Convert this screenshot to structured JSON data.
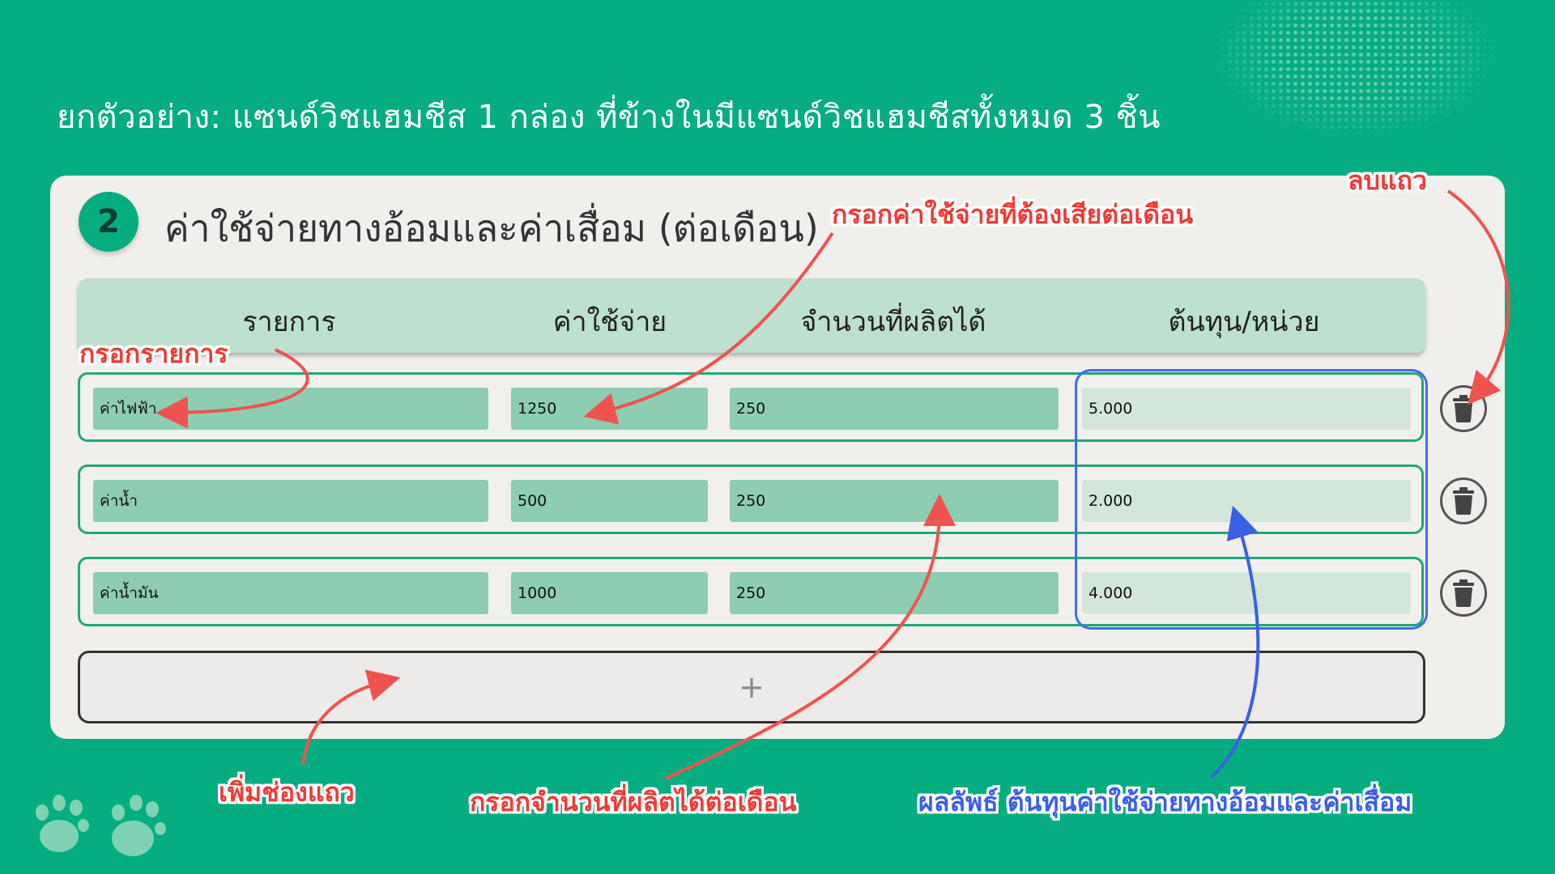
{
  "top_caption": "ยกตัวอย่าง: แซนด์วิชแฮมชีส 1 กล่อง ที่ข้างในมีแซนด์วิชแฮมชีสทั้งหมด 3 ชิ้น",
  "section": {
    "step_number": "2",
    "title": "ค่าใช้จ่ายทางอ้อมและค่าเสื่อม (ต่อเดือน)"
  },
  "table": {
    "headers": [
      "รายการ",
      "ค่าใช้จ่าย",
      "จำนวนที่ผลิตได้",
      "ต้นทุน/หน่วย"
    ],
    "rows": [
      {
        "name": "ค่าไฟฟ้า",
        "cost": "1250",
        "qty": "250",
        "unit_cost": "5.000"
      },
      {
        "name": "ค่าน้ำ",
        "cost": "500",
        "qty": "250",
        "unit_cost": "2.000"
      },
      {
        "name": "ค่าน้ำมัน",
        "cost": "1000",
        "qty": "250",
        "unit_cost": "4.000"
      }
    ],
    "add_row_symbol": "+"
  },
  "annotations": {
    "enter_item": "กรอกรายการ",
    "enter_cost": "กรอกค่าใช้จ่ายที่ต้องเสียต่อเดือน",
    "delete_row": "ลบแถว",
    "add_row": "เพิ่มช่องแถว",
    "enter_qty": "กรอกจำนวนที่ผลิตได้ต่อเดือน",
    "result": "ผลลัพธ์ ต้นทุนค่าใช้จ่ายทางอ้อมและค่าเสื่อม"
  },
  "icons": {
    "delete": "trash-icon",
    "add": "plus-icon"
  },
  "colors": {
    "background": "#06ad80",
    "card": "#f1efec",
    "header": "#bde0cf",
    "input": "#8dcdb1",
    "result_input": "#d3e6da",
    "annotation_red": "#ef3b36",
    "annotation_blue": "#3a5fe8"
  }
}
